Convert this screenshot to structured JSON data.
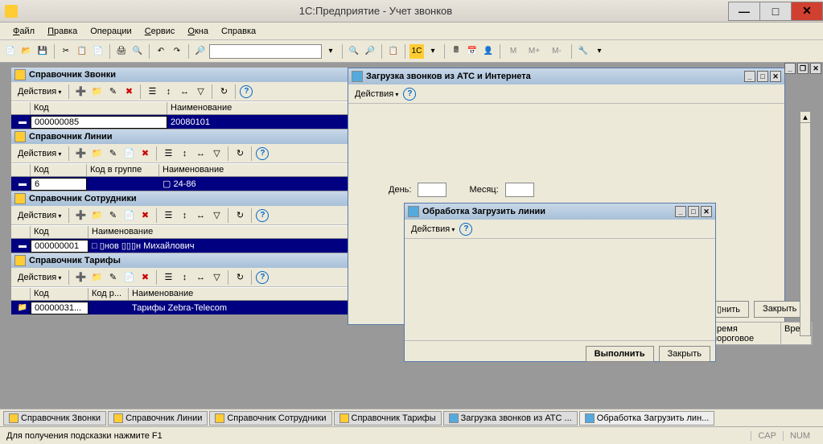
{
  "title": "1С:Предприятие - Учет звонков",
  "menu": {
    "file": "Файл",
    "edit": "Правка",
    "ops": "Операции",
    "service": "Сервис",
    "windows": "Окна",
    "help": "Справка"
  },
  "actions_label": "Действия",
  "ref_calls": {
    "title": "Справочник Звонки",
    "cols": {
      "code": "Код",
      "name": "Наименование"
    },
    "row": {
      "code": "000000085",
      "name": "20080101"
    }
  },
  "ref_lines": {
    "title": "Справочник Линии",
    "cols": {
      "code": "Код",
      "group": "Код в группе",
      "name": "Наименование"
    },
    "row": {
      "code": "6",
      "group": "",
      "name": "▢ 24-86"
    }
  },
  "ref_emp": {
    "title": "Справочник Сотрудники",
    "cols": {
      "code": "Код",
      "name": "Наименование"
    },
    "row": {
      "code": "000000001",
      "name": "□ ▯нов ▯▯▯н Михайлович"
    }
  },
  "ref_tar": {
    "title": "Справочник Тарифы",
    "cols": {
      "code": "Код",
      "codr": "Код р...",
      "name": "Наименование"
    },
    "row": {
      "code": "00000031...",
      "codr": "",
      "name": "Тарифы Zebra-Telecom"
    }
  },
  "load_win": {
    "title": "Загрузка звонков из АТС и Интернета",
    "day": "День:",
    "month": "Месяц:",
    "cols": {
      "threshold": "▯ремя пороговое",
      "time": "Вре▯"
    },
    "ok": "▯нить",
    "close": "Закрыть"
  },
  "lines_win": {
    "title": "Обработка  Загрузить линии",
    "ok": "Выполнить",
    "close": "Закрыть"
  },
  "tabs": {
    "t1": "Справочник Звонки",
    "t2": "Справочник Линии",
    "t3": "Справочник Сотрудники",
    "t4": "Справочник Тарифы",
    "t5": "Загрузка звонков из АТС ...",
    "t6": "Обработка  Загрузить лин..."
  },
  "status": {
    "hint": "Для получения подсказки нажмите F1",
    "cap": "CAP",
    "num": "NUM"
  },
  "m_buttons": {
    "m": "M",
    "mp": "M+",
    "mm": "M-"
  }
}
